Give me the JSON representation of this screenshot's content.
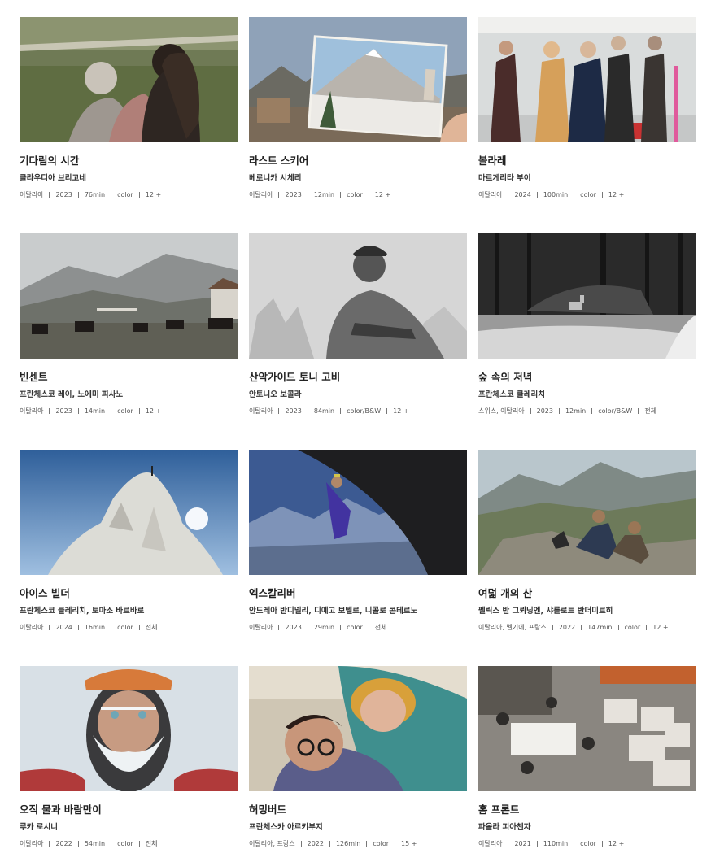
{
  "films": [
    {
      "title": "기다림의 시간",
      "director": "클라우디아 브리고네",
      "meta": [
        "이탈리아",
        "2023",
        "76min",
        "color",
        "12 +"
      ],
      "thumb": "thumb-two-women-meadow"
    },
    {
      "title": "라스트 스키어",
      "director": "베로니카 시체리",
      "meta": [
        "이탈리아",
        "2023",
        "12min",
        "color",
        "12 +"
      ],
      "thumb": "thumb-hand-holding-postcard"
    },
    {
      "title": "볼라레",
      "director": "마르게리타 부이",
      "meta": [
        "이탈리아",
        "2024",
        "100min",
        "color",
        "12 +"
      ],
      "thumb": "thumb-people-in-airport"
    },
    {
      "title": "빈센트",
      "director": "프란체스코 레이, 노에미 피사노",
      "meta": [
        "이탈리아",
        "2023",
        "14min",
        "color",
        "12 +"
      ],
      "thumb": "thumb-cattle-in-valley"
    },
    {
      "title": "산악가이드 토니 고비",
      "director": "안토니오 보콜라",
      "meta": [
        "이탈리아",
        "2023",
        "84min",
        "color/B&W",
        "12 +"
      ],
      "thumb": "thumb-mountaineer-portrait"
    },
    {
      "title": "숲 속의 저녁",
      "director": "프란체스코 클레리치",
      "meta": [
        "스위스, 이탈리아",
        "2023",
        "12min",
        "color/B&W",
        "전체"
      ],
      "thumb": "thumb-deer-in-forest"
    },
    {
      "title": "아이스 빌더",
      "director": "프란체스코 클레리치, 토마소 바르바로",
      "meta": [
        "이탈리아",
        "2024",
        "16min",
        "color",
        "전체"
      ],
      "thumb": "thumb-ice-tower"
    },
    {
      "title": "엑스칼리버",
      "director": "안드레아 반디넬리, 디에고 보텔로, 니콜로 콘테르노",
      "meta": [
        "이탈리아",
        "2023",
        "29min",
        "color",
        "전체"
      ],
      "thumb": "thumb-rock-climber"
    },
    {
      "title": "여덟 개의 산",
      "director": "펠릭스 반 그뢰닝엔, 샤를로트 반더미르히",
      "meta": [
        "이탈리아, 벨기에, 프랑스",
        "2022",
        "147min",
        "color",
        "12 +"
      ],
      "thumb": "thumb-two-men-on-rocks"
    },
    {
      "title": "오직 물과 바람만이",
      "director": "루카 로시니",
      "meta": [
        "이탈리아",
        "2022",
        "54min",
        "color",
        "전체"
      ],
      "thumb": "thumb-frozen-beard-man"
    },
    {
      "title": "허밍버드",
      "director": "프란체스카 아르키부지",
      "meta": [
        "이탈리아, 프랑스",
        "2022",
        "126min",
        "color",
        "15 +"
      ],
      "thumb": "thumb-couple-in-bed"
    },
    {
      "title": "홈 프론트",
      "director": "파올라 피아첸자",
      "meta": [
        "이탈리아",
        "2021",
        "110min",
        "color",
        "12 +"
      ],
      "thumb": "thumb-warehouse-overhead"
    }
  ]
}
